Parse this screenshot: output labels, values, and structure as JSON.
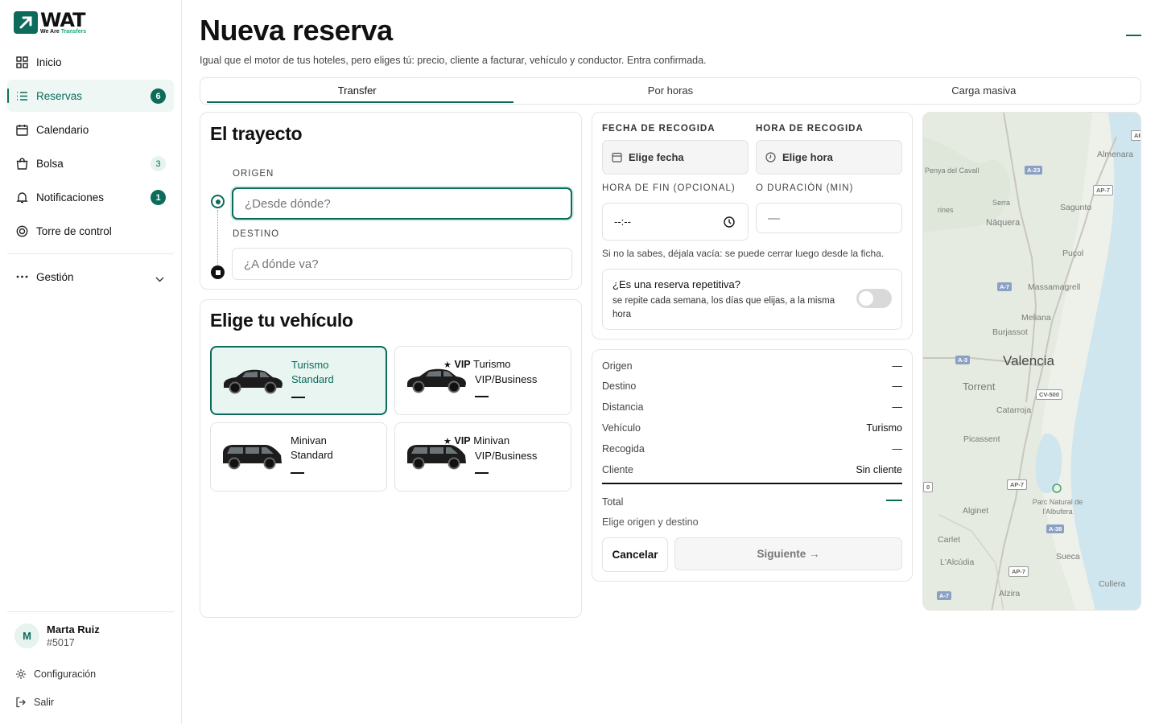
{
  "brand": {
    "name": "WAT",
    "tagline_a": "We Are ",
    "tagline_b": "Transfers",
    "accent": "#0d6b5c"
  },
  "sidebar": {
    "items": [
      {
        "label": "Inicio",
        "icon": "grid-icon"
      },
      {
        "label": "Reservas",
        "icon": "list-icon",
        "badge": "6",
        "active": true
      },
      {
        "label": "Calendario",
        "icon": "calendar-icon"
      },
      {
        "label": "Bolsa",
        "icon": "bag-icon",
        "badge": "3"
      },
      {
        "label": "Notificaciones",
        "icon": "bell-icon",
        "badge": "1"
      },
      {
        "label": "Torre de control",
        "icon": "target-icon"
      }
    ],
    "group": {
      "label": "Gestión",
      "icon": "dots-icon"
    },
    "user": {
      "initial": "M",
      "name": "Marta Ruiz",
      "id": "#5017"
    },
    "settings_label": "Configuración",
    "logout_label": "Salir"
  },
  "header": {
    "title": "Nueva reserva",
    "subtitle": "Igual que el motor de tus hoteles, pero eliges tú: precio, cliente a facturar, vehículo y conductor. Entra confirmada."
  },
  "tabs": [
    {
      "label": "Transfer",
      "active": true
    },
    {
      "label": "Por horas"
    },
    {
      "label": "Carga masiva"
    }
  ],
  "route": {
    "title": "El trayecto",
    "origin_label": "ORIGEN",
    "origin_placeholder": "¿Desde dónde?",
    "dest_label": "DESTINO",
    "dest_placeholder": "¿A dónde va?"
  },
  "vehicles": {
    "title": "Elige tu vehículo",
    "items": [
      {
        "vip": "",
        "line1": "Turismo",
        "line2": "Standard",
        "selected": true
      },
      {
        "vip": "VIP",
        "line1": "Turismo",
        "line2": "VIP/Business"
      },
      {
        "vip": "",
        "line1": "Minivan",
        "line2": "Standard"
      },
      {
        "vip": "VIP",
        "line1": "Minivan",
        "line2": "VIP/Business"
      }
    ],
    "price_placeholder": "—"
  },
  "schedule": {
    "date_label": "FECHA DE RECOGIDA",
    "date_value": "Elige fecha",
    "time_label": "HORA DE RECOGIDA",
    "time_value": "Elige hora",
    "end_label": "HORA DE FIN (OPCIONAL)",
    "end_value": "--:--",
    "duration_label": "O DURACIÓN (MIN)",
    "duration_placeholder": "—",
    "hint": "Si no la sabes, déjala vacía: se puede cerrar luego desde la ficha.",
    "repeat_title": "¿Es una reserva repetitiva?",
    "repeat_desc": "se repite cada semana, los días que elijas, a la misma hora",
    "repeat_on": false
  },
  "summary": {
    "rows": [
      {
        "label": "Origen",
        "value": "—"
      },
      {
        "label": "Destino",
        "value": "—"
      },
      {
        "label": "Distancia",
        "value": "—"
      },
      {
        "label": "Vehículo",
        "value": "Turismo"
      },
      {
        "label": "Recogida",
        "value": "—"
      },
      {
        "label": "Cliente",
        "value": "Sin cliente"
      }
    ],
    "total_label": "Total",
    "total_hint": "Elige origen y destino",
    "cancel_label": "Cancelar",
    "next_label": "Siguiente →"
  },
  "map": {
    "places": [
      "Almenara",
      "Penya del Cavall",
      "Sagunto",
      "Serra",
      "Náquera",
      "Puçol",
      "Massamagrell",
      "Meliana",
      "Burjassot",
      "Valencia",
      "Torrent",
      "Catarroja",
      "Picassent",
      "Parc Natural de l'Albufera",
      "Alginet",
      "Carlet",
      "L'Alcúdia",
      "Sueca",
      "Alzira",
      "Cullera",
      "rines"
    ],
    "roads": [
      "A-23",
      "AP-7",
      "A-7",
      "A-3",
      "CV-500",
      "AP-7",
      "A-38",
      "AP-7",
      "A-7",
      "AP",
      "0"
    ]
  }
}
